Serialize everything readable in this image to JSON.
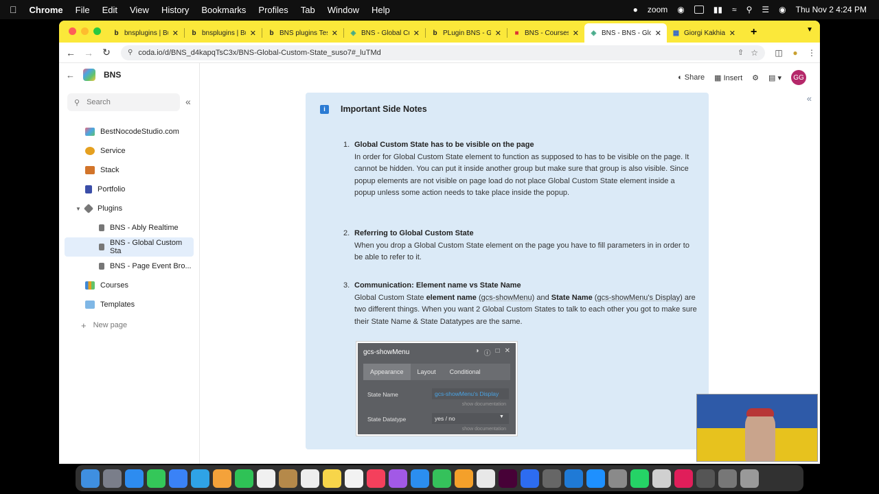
{
  "menubar": {
    "app": "Chrome",
    "items": [
      "File",
      "Edit",
      "View",
      "History",
      "Bookmarks",
      "Profiles",
      "Tab",
      "Window",
      "Help"
    ],
    "zoom": "zoom",
    "datetime": "Thu Nov 2  4:24 PM"
  },
  "tabs": [
    {
      "label": "bnsplugins | Bub",
      "icon": "bubble-b-icon",
      "active": false
    },
    {
      "label": "bnsplugins | Bub",
      "icon": "bubble-b-icon",
      "active": false
    },
    {
      "label": "BNS plugins Tes",
      "icon": "bubble-b-icon",
      "active": false
    },
    {
      "label": "BNS - Global Cu",
      "icon": "coda-icon",
      "active": false
    },
    {
      "label": "PLugin BNS - Gl",
      "icon": "bubble-b-icon",
      "active": false
    },
    {
      "label": "BNS - Courses",
      "icon": "coda-red-icon",
      "active": false
    },
    {
      "label": "BNS - BNS - Glo",
      "icon": "coda-icon",
      "active": true
    },
    {
      "label": "Giorgi Kakhiani -",
      "icon": "doc-icon",
      "active": false
    }
  ],
  "address": {
    "url": "coda.io/d/BNS_d4kapqTsC3x/BNS-Global-Custom-State_suso7#_luTMd"
  },
  "sidebar": {
    "doc_title": "BNS",
    "search_placeholder": "Search",
    "items": [
      {
        "label": "BestNocodeStudio.com",
        "color": "#e86a7f",
        "level": 0
      },
      {
        "label": "Service",
        "color": "#e5a020",
        "level": 0
      },
      {
        "label": "Stack",
        "color": "#d2742a",
        "level": 0
      },
      {
        "label": "Portfolio",
        "color": "#3b4ea8",
        "level": 0
      },
      {
        "label": "Plugins",
        "color": "#555555",
        "level": 0
      },
      {
        "label": "BNS - Ably Realtime",
        "color": "#555555",
        "level": 1
      },
      {
        "label": "BNS - Global Custom Sta",
        "color": "#555555",
        "level": 1,
        "selected": true
      },
      {
        "label": "BNS - Page Event Bro...",
        "color": "#555555",
        "level": 1
      },
      {
        "label": "Courses",
        "color": "#3f88d6",
        "level": 0
      },
      {
        "label": "Templates",
        "color": "#7fb7e6",
        "level": 0
      }
    ],
    "new_page": "New page"
  },
  "toolbar": {
    "share": "Share",
    "insert": "Insert",
    "avatar": "GG"
  },
  "callout": {
    "title": "Important Side Notes",
    "items": [
      {
        "num": "1.",
        "title": "Global Custom State has to be visible on the page",
        "text": "In order for Global Custom State element to function as supposed to has to be visible on the page. It cannot be hidden. You can put it inside another group but make sure that group is also visible. Since popup elements are not visible on page load do not place Global Custom State element inside a popup unless some action needs to take place inside the popup."
      },
      {
        "num": "2.",
        "title": "Referring to Global Custom State",
        "text": "When you drop a Global Custom State element on the page you have to fill parameters in in order to be able to refer to it."
      },
      {
        "num": "3.",
        "title": "Communication: Element name vs State Name",
        "text_a": "Global Custom State ",
        "bold_a": "element name",
        "text_b": " (",
        "code_a": "gcs-showMenu",
        "text_c": ") and ",
        "bold_b": "State Name",
        "text_d": " (",
        "code_b": "gcs-showMenu's Display",
        "text_e": ") are two different things. When you want 2 Global Custom States to talk to each other you got to make sure their State Name & State Datatypes are the same."
      }
    ]
  },
  "panel": {
    "title": "gcs-showMenu",
    "tabs": [
      "Appearance",
      "Layout",
      "Conditional"
    ],
    "state_name_label": "State Name",
    "state_name_value": "gcs-showMenu's Display",
    "state_datatype_label": "State Datatype",
    "state_datatype_value": "yes / no",
    "show_doc": "show documentation"
  }
}
